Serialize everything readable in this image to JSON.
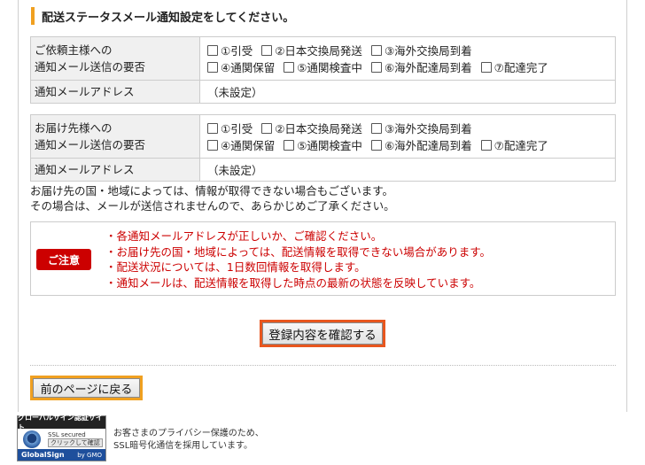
{
  "heading": "配送ステータスメール通知設定をしてください。",
  "sender_section": {
    "label_line1": "ご依頼主様への",
    "label_line2": "通知メール送信の要否",
    "options_row1": [
      "①引受",
      "②日本交換局発送",
      "③海外交換局到着"
    ],
    "options_row2": [
      "④通関保留",
      "⑤通関検査中",
      "⑥海外配達局到着",
      "⑦配達完了"
    ],
    "email_label": "通知メールアドレス",
    "email_value": "（未設定）"
  },
  "recipient_section": {
    "label_line1": "お届け先様への",
    "label_line2": "通知メール送信の要否",
    "options_row1": [
      "①引受",
      "②日本交換局発送",
      "③海外交換局到着"
    ],
    "options_row2": [
      "④通関保留",
      "⑤通関検査中",
      "⑥海外配達局到着",
      "⑦配達完了"
    ],
    "email_label": "通知メールアドレス",
    "email_value": "（未設定）"
  },
  "note": {
    "line1": "お届け先の国・地域によっては、情報が取得できない場合もございます。",
    "line2": "その場合は、メールが送信されませんので、あらかじめご了承ください。"
  },
  "caution": {
    "badge": "ご注意",
    "items": [
      "・各通知メールアドレスが正しいか、ご確認ください。",
      "・お届け先の国・地域によっては、配送情報を取得できない場合があります。",
      "・配送状況については、1日数回情報を取得します。",
      "・通知メールは、配送情報を取得した時点の最新の状態を反映しています。"
    ]
  },
  "confirm_button": "登録内容を確認する",
  "back_button": "前のページに戻る",
  "ssl_seal": {
    "top": "グローバルサイン認証サイト",
    "ssl_secured": "SSL secured",
    "click": "クリックして確認",
    "brand": "GlobalSign",
    "gmo": "by GMO"
  },
  "ssl_text": {
    "line1": "お客さまのプライバシー保護のため、",
    "line2": "SSL暗号化通信を採用しています。"
  },
  "colors": {
    "accent_orange": "#f0a020",
    "confirm_border": "#e8561e",
    "caution_red": "#cc0000"
  }
}
